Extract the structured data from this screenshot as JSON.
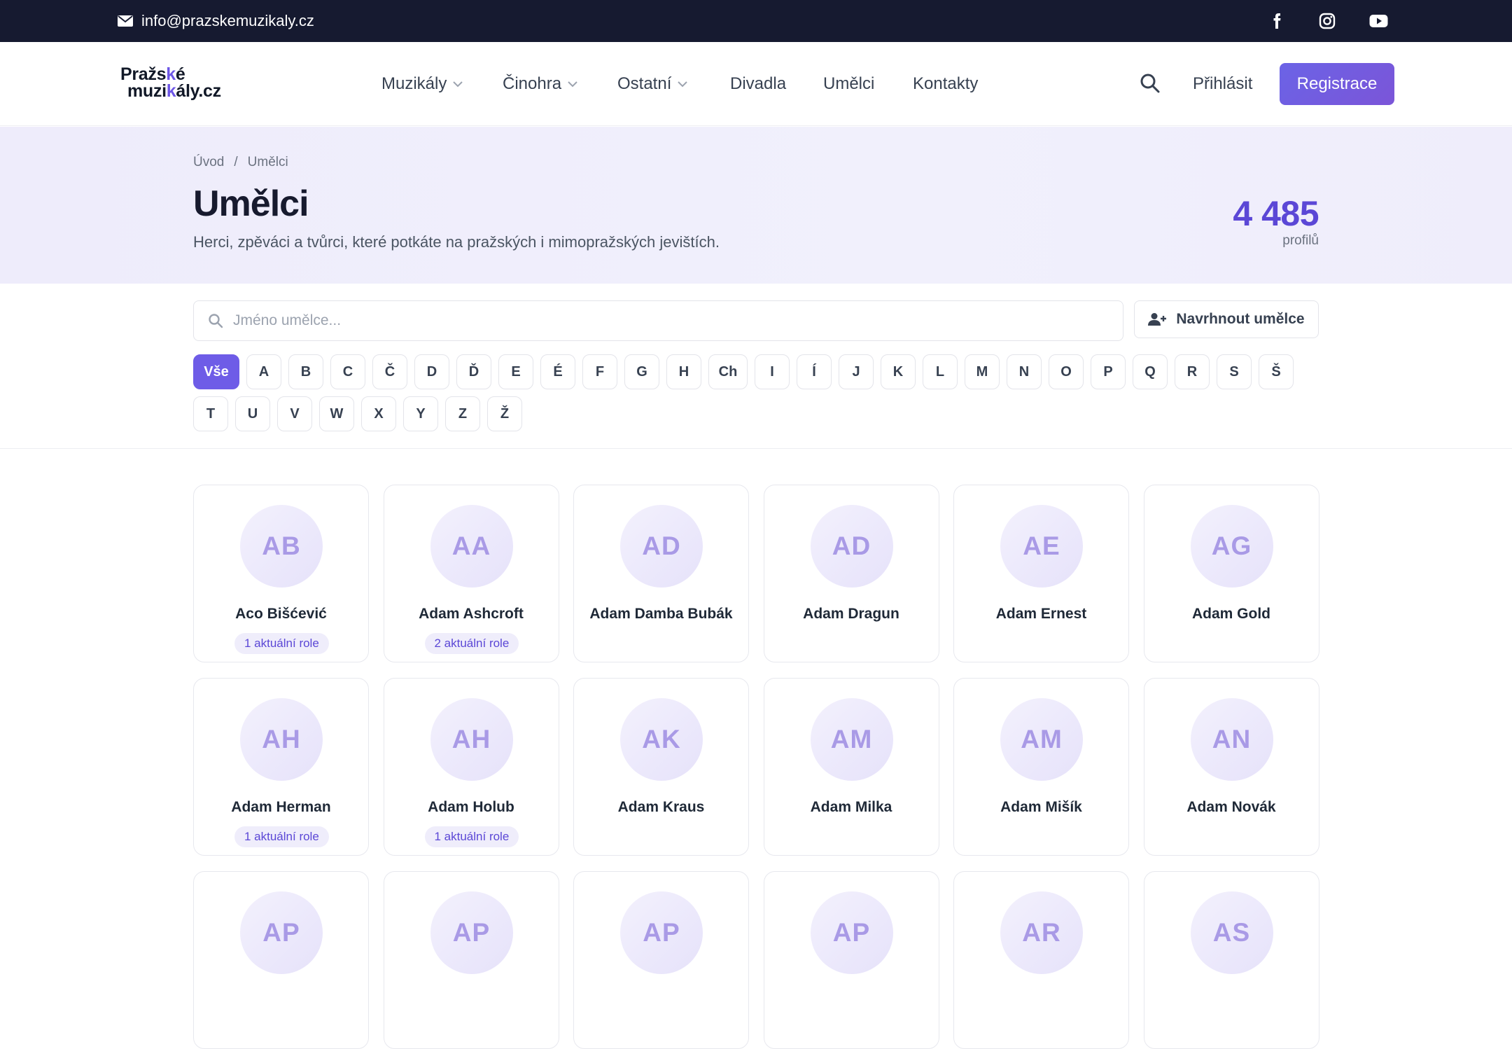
{
  "topbar": {
    "email": "info@prazskemuzikaly.cz",
    "social": [
      {
        "icon": "facebook-icon"
      },
      {
        "icon": "instagram-icon"
      },
      {
        "icon": "youtube-icon"
      }
    ]
  },
  "header": {
    "logo_line1_a": "Pražs",
    "logo_line1_b": "k",
    "logo_line1_c": "é",
    "logo_line2_a": "muzi",
    "logo_line2_b": "k",
    "logo_line2_c": "ály.cz",
    "nav": [
      {
        "label": "Muzikály",
        "dropdown": true
      },
      {
        "label": "Činohra",
        "dropdown": true
      },
      {
        "label": "Ostatní",
        "dropdown": true
      },
      {
        "label": "Divadla",
        "dropdown": false
      },
      {
        "label": "Umělci",
        "dropdown": false
      },
      {
        "label": "Kontakty",
        "dropdown": false
      }
    ],
    "login_label": "Přihlásit",
    "register_label": "Registrace"
  },
  "hero": {
    "breadcrumb": [
      "Úvod",
      "/",
      "Umělci"
    ],
    "title": "Umělci",
    "subtitle": "Herci, zpěváci a tvůrci, které potkáte na pražských i mimopražských jevištích.",
    "count": "4 485",
    "count_label": "profilů"
  },
  "search": {
    "placeholder": "Jméno umělce...",
    "value": "",
    "suggest_label": "Navrhnout umělce"
  },
  "letters": {
    "active": "Vše",
    "row1": [
      "Vše",
      "A",
      "B",
      "C",
      "Č",
      "D",
      "Ď",
      "E",
      "É",
      "F",
      "G",
      "H",
      "Ch",
      "I",
      "Í",
      "J",
      "K",
      "L",
      "M",
      "N",
      "O",
      "P",
      "Q",
      "R",
      "S",
      "Š"
    ],
    "row2": [
      "T",
      "U",
      "V",
      "W",
      "X",
      "Y",
      "Z",
      "Ž"
    ]
  },
  "artists": [
    {
      "initials": "AB",
      "name": "Aco Bišćević",
      "roles": "1 aktuální role"
    },
    {
      "initials": "AA",
      "name": "Adam Ashcroft",
      "roles": "2 aktuální role"
    },
    {
      "initials": "AD",
      "name": "Adam Damba Bubák",
      "roles": ""
    },
    {
      "initials": "AD",
      "name": "Adam Dragun",
      "roles": ""
    },
    {
      "initials": "AE",
      "name": "Adam Ernest",
      "roles": ""
    },
    {
      "initials": "AG",
      "name": "Adam Gold",
      "roles": ""
    },
    {
      "initials": "AH",
      "name": "Adam Herman",
      "roles": "1 aktuální role"
    },
    {
      "initials": "AH",
      "name": "Adam Holub",
      "roles": "1 aktuální role"
    },
    {
      "initials": "AK",
      "name": "Adam Kraus",
      "roles": ""
    },
    {
      "initials": "AM",
      "name": "Adam Milka",
      "roles": ""
    },
    {
      "initials": "AM",
      "name": "Adam Mišík",
      "roles": ""
    },
    {
      "initials": "AN",
      "name": "Adam Novák",
      "roles": ""
    },
    {
      "initials": "AP",
      "name": "",
      "roles": ""
    },
    {
      "initials": "AP",
      "name": "",
      "roles": ""
    },
    {
      "initials": "AP",
      "name": "",
      "roles": ""
    },
    {
      "initials": "AP",
      "name": "",
      "roles": ""
    },
    {
      "initials": "AR",
      "name": "",
      "roles": ""
    },
    {
      "initials": "AS",
      "name": "",
      "roles": ""
    }
  ],
  "colors": {
    "topbar": "#161a30",
    "accent": "#6e5ce7",
    "count": "#5b47d6",
    "avatar_text": "#a99ae6"
  }
}
